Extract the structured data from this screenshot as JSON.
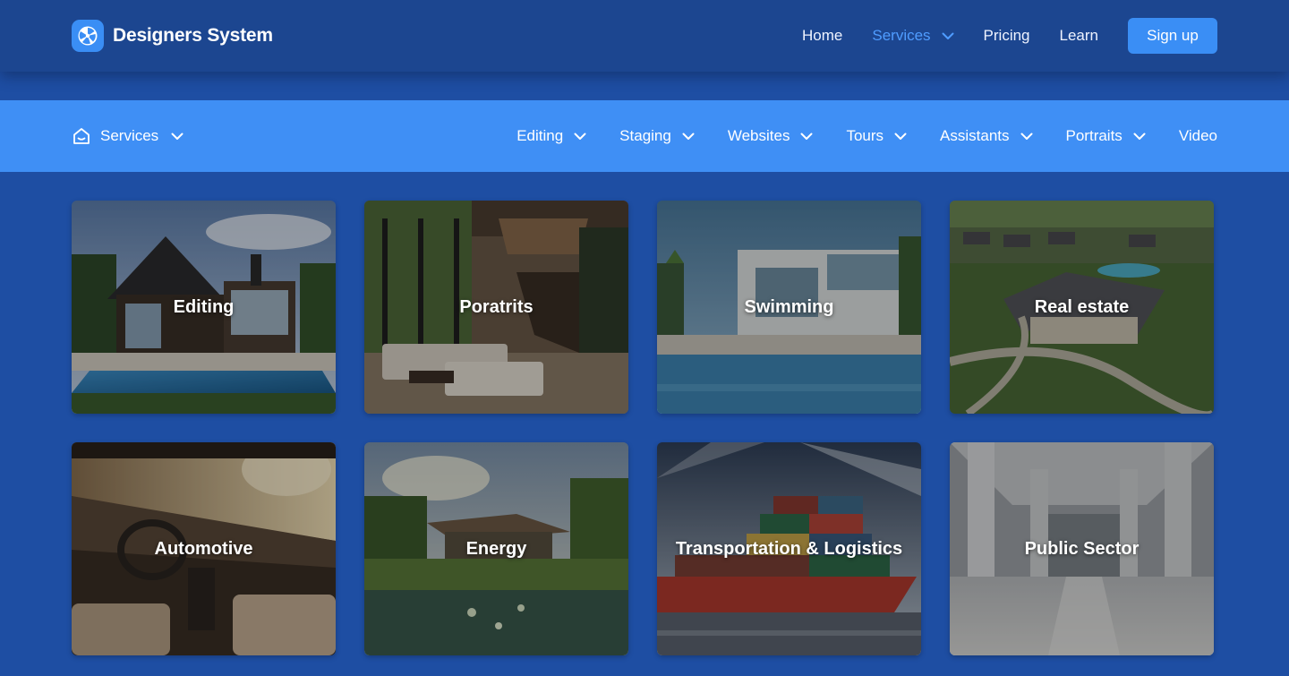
{
  "header": {
    "brand": "Designers System",
    "nav": [
      {
        "label": "Home"
      },
      {
        "label": "Services"
      },
      {
        "label": "Pricing"
      },
      {
        "label": "Learn"
      }
    ],
    "signup_label": "Sign up",
    "active_nav": "Services"
  },
  "subnav": {
    "root_label": "Services",
    "items": [
      {
        "label": "Editing"
      },
      {
        "label": "Staging"
      },
      {
        "label": "Websites"
      },
      {
        "label": "Tours"
      },
      {
        "label": "Assistants"
      },
      {
        "label": "Portraits"
      },
      {
        "label": "Video"
      }
    ]
  },
  "cards": [
    {
      "title": "Editing"
    },
    {
      "title": "Poratrits"
    },
    {
      "title": "Swimming"
    },
    {
      "title": "Real estate"
    },
    {
      "title": "Automotive"
    },
    {
      "title": "Energy"
    },
    {
      "title": "Transportation & Logistics"
    },
    {
      "title": "Public Sector"
    }
  ],
  "colors": {
    "header_bg": "#1c4690",
    "page_bg": "#1e4ea3",
    "subnav_bg": "#3f8ff5",
    "accent": "#3a8ef5",
    "active_link": "#4f9cff"
  },
  "icons": {
    "logo": "aperture-logo-icon",
    "services": "home-icon",
    "dropdown": "chevron-down-icon"
  }
}
